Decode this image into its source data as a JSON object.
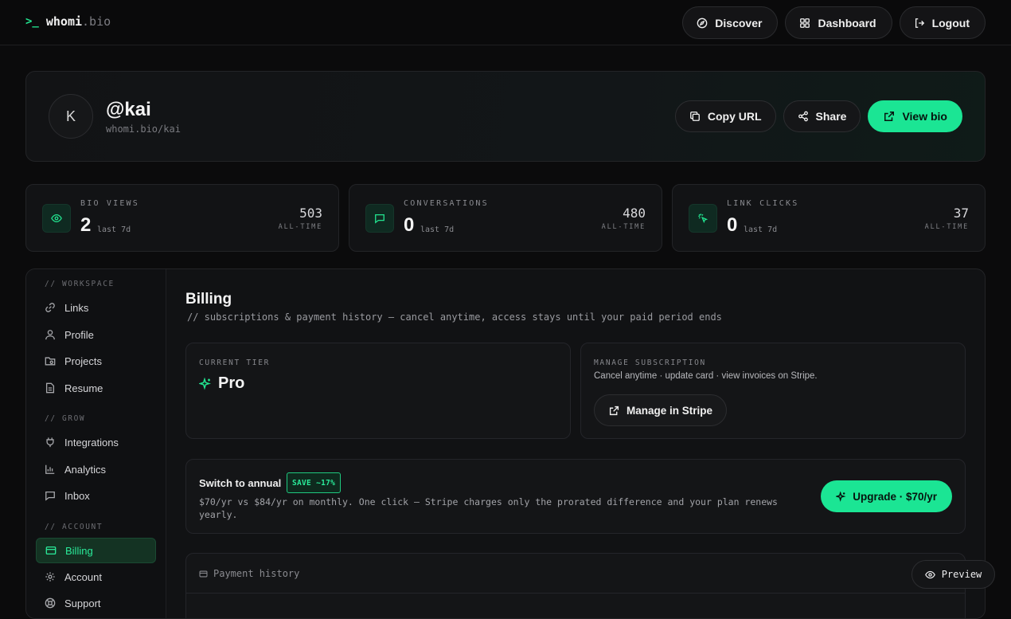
{
  "brand": {
    "prompt": ">_",
    "name": "whomi",
    "tld": ".bio"
  },
  "nav": {
    "discover": "Discover",
    "dashboard": "Dashboard",
    "logout": "Logout"
  },
  "profile": {
    "avatar_letter": "K",
    "handle": "@kai",
    "url": "whomi.bio/kai",
    "copy_url": "Copy URL",
    "share": "Share",
    "view_bio": "View bio"
  },
  "stats": [
    {
      "label": "BIO VIEWS",
      "value": "2",
      "unit": "last 7d",
      "alltime": "503",
      "alltime_label": "ALL-TIME",
      "icon": "eye-icon"
    },
    {
      "label": "CONVERSATIONS",
      "value": "0",
      "unit": "last 7d",
      "alltime": "480",
      "alltime_label": "ALL-TIME",
      "icon": "message-icon"
    },
    {
      "label": "LINK CLICKS",
      "value": "0",
      "unit": "last 7d",
      "alltime": "37",
      "alltime_label": "ALL-TIME",
      "icon": "click-icon"
    }
  ],
  "sidebar": {
    "workspace_title": "// WORKSPACE",
    "grow_title": "// GROW",
    "account_title": "// ACCOUNT",
    "items": {
      "links": "Links",
      "profile": "Profile",
      "projects": "Projects",
      "resume": "Resume",
      "integrations": "Integrations",
      "analytics": "Analytics",
      "inbox": "Inbox",
      "billing": "Billing",
      "account": "Account",
      "support": "Support"
    }
  },
  "billing": {
    "title": "Billing",
    "subtitle": "// subscriptions & payment history — cancel anytime, access stays until your paid period ends",
    "current_tier_label": "CURRENT TIER",
    "current_tier": "Pro",
    "manage_label": "MANAGE SUBSCRIPTION",
    "manage_desc": "Cancel anytime · update card · view invoices on Stripe.",
    "manage_button": "Manage in Stripe",
    "switch_title": "Switch to annual",
    "save_badge": "SAVE ~17%",
    "switch_desc": "$70/yr vs $84/yr on monthly. One click — Stripe charges only the prorated difference and your plan renews yearly.",
    "upgrade_button": "Upgrade · $70/yr",
    "payment_history": "Payment history"
  },
  "preview_button": "Preview",
  "colors": {
    "accent": "#1be594",
    "background": "#0b0b0c",
    "card": "#121315"
  }
}
